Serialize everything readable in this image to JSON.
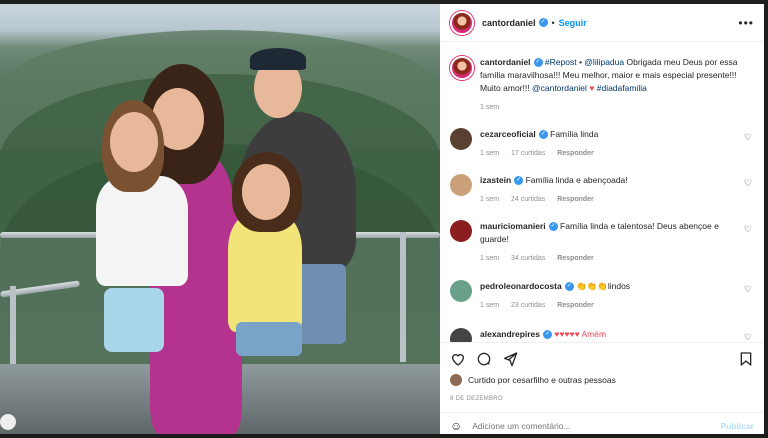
{
  "header": {
    "username": "cantordaniel",
    "separator": "•",
    "follow_label": "Seguir",
    "more_label": "•••"
  },
  "caption": {
    "username": "cantordaniel",
    "repost": "#Repost",
    "mention": "@lilipadua",
    "text": "Obrigada meu Deus por essa família maravilhosa!!! Meu melhor, maior e mais especial presente!!! Muito amor!!!",
    "mention2": "@cantordaniel",
    "hashtag": "#diadafamilia",
    "time": "1 sem"
  },
  "comments": [
    {
      "username": "cezarceoficial",
      "text": "Família linda",
      "time": "1 sem",
      "likes": "17 curtidas",
      "reply": "Responder"
    },
    {
      "username": "izastein",
      "text": "Família linda e abençoada!",
      "time": "1 sem",
      "likes": "24 curtidas",
      "reply": "Responder"
    },
    {
      "username": "mauriciomanieri",
      "text": "Família linda e talentosa! Deus abençoe e guarde!",
      "time": "1 sem",
      "likes": "34 curtidas",
      "reply": "Responder"
    },
    {
      "username": "pedroleonardocosta",
      "text": "👏👏👏lindos",
      "time": "1 sem",
      "likes": "23 curtidas",
      "reply": "Responder"
    },
    {
      "username": "alexandrepires",
      "text": "♥♥♥♥♥ Amém",
      "time": "",
      "likes": "",
      "reply": ""
    }
  ],
  "liked_by": "Curtido por cesarfilho e outras pessoas",
  "date": "8 DE DEZEMBRO",
  "add_comment": {
    "placeholder": "Adicione um comentário...",
    "publish_label": "Publicar"
  },
  "colors": {
    "accent": "#0095f6",
    "verified": "#3897f0",
    "heart": "#ed4956"
  },
  "icons": [
    "like-icon",
    "comment-icon",
    "share-icon",
    "save-icon",
    "emoji-icon",
    "more-icon",
    "verified-icon"
  ]
}
